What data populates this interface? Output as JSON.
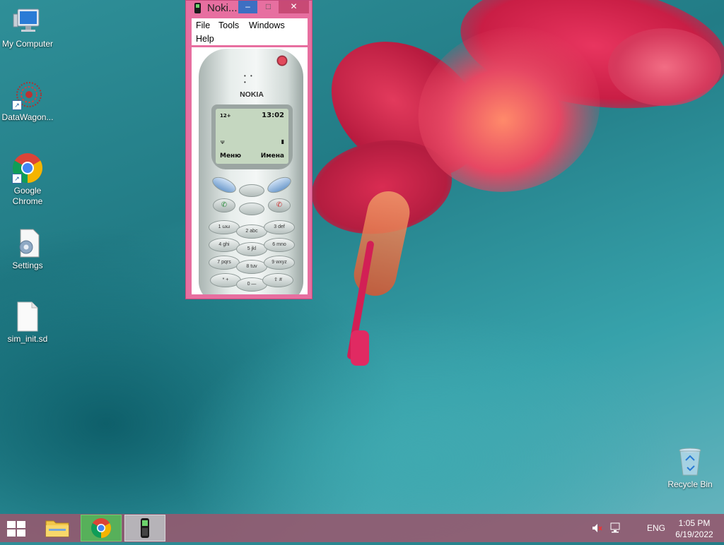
{
  "desktop": {
    "icons": [
      {
        "label": "My Computer",
        "icon": "monitor-icon"
      },
      {
        "label": "DataWagon...",
        "icon": "datawagon-icon",
        "shortcut": true
      },
      {
        "label": "Google Chrome",
        "icon": "chrome-icon",
        "shortcut": true
      },
      {
        "label": "Settings",
        "icon": "settings-document-icon"
      },
      {
        "label": "sim_init.sd",
        "icon": "blank-file-icon"
      }
    ],
    "recycle_bin": {
      "label": "Recycle Bin",
      "icon": "recycle-bin-icon"
    }
  },
  "window": {
    "title": "Noki...",
    "minimize_glyph": "–",
    "maximize_glyph": "□",
    "close_glyph": "✕",
    "menu": [
      "File",
      "Tools",
      "Windows",
      "Help"
    ]
  },
  "phone": {
    "brand": "NOKIA",
    "signal": "12+",
    "time": "13:02",
    "softkey_left": "Меню",
    "softkey_right": "Имена",
    "keys": [
      {
        "main": "1",
        "sub": "ωω"
      },
      {
        "main": "2",
        "sub": "abc"
      },
      {
        "main": "3",
        "sub": "def"
      },
      {
        "main": "4",
        "sub": "ghi"
      },
      {
        "main": "5",
        "sub": "jkl"
      },
      {
        "main": "6",
        "sub": "mno"
      },
      {
        "main": "7",
        "sub": "pqrs"
      },
      {
        "main": "8",
        "sub": "tuv"
      },
      {
        "main": "9",
        "sub": "wxyz"
      },
      {
        "main": "*",
        "sub": "+"
      },
      {
        "main": "0",
        "sub": "—"
      },
      {
        "main": "#",
        "sub": "⇧"
      }
    ]
  },
  "taskbar": {
    "apps": [
      {
        "name": "File Explorer",
        "icon": "folder-icon"
      },
      {
        "name": "Google Chrome",
        "icon": "chrome-icon"
      },
      {
        "name": "Nokia",
        "icon": "phone-icon"
      }
    ],
    "language": "ENG",
    "time": "1:05 PM",
    "date": "6/19/2022",
    "tray_icons": [
      "speaker-muted-icon",
      "network-icon"
    ]
  },
  "colors": {
    "window_frame": "#e76fa0",
    "taskbar": "#925a70",
    "screen_lcd": "#c5d7c0"
  }
}
